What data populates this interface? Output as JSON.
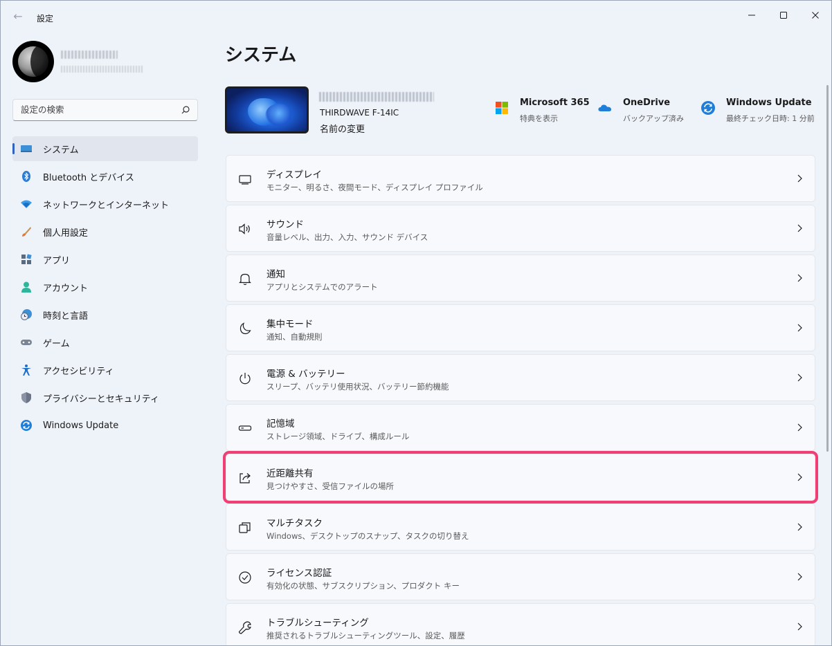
{
  "window": {
    "app_title": "設定",
    "back_glyph": "←"
  },
  "sidebar": {
    "search_placeholder": "設定の検索",
    "items": [
      {
        "label": "システム",
        "icon": "monitor-icon",
        "active": true
      },
      {
        "label": "Bluetooth とデバイス",
        "icon": "bluetooth-icon"
      },
      {
        "label": "ネットワークとインターネット",
        "icon": "wifi-icon"
      },
      {
        "label": "個人用設定",
        "icon": "brush-icon"
      },
      {
        "label": "アプリ",
        "icon": "apps-icon"
      },
      {
        "label": "アカウント",
        "icon": "person-icon"
      },
      {
        "label": "時刻と言語",
        "icon": "clock-globe-icon"
      },
      {
        "label": "ゲーム",
        "icon": "gamepad-icon"
      },
      {
        "label": "アクセシビリティ",
        "icon": "accessibility-icon"
      },
      {
        "label": "プライバシーとセキュリティ",
        "icon": "shield-icon"
      },
      {
        "label": "Windows Update",
        "icon": "update-icon"
      }
    ]
  },
  "main": {
    "title": "システム",
    "device": {
      "model": "THIRDWAVE F-14IC",
      "rename_label": "名前の変更"
    },
    "quick_links": [
      {
        "title": "Microsoft 365",
        "subtitle": "特典を表示",
        "icon": "microsoft-logo-icon"
      },
      {
        "title": "OneDrive",
        "subtitle": "バックアップ済み",
        "icon": "cloud-icon"
      },
      {
        "title": "Windows Update",
        "subtitle": "最終チェック日時: 1 分前",
        "icon": "update-icon"
      }
    ],
    "cards": [
      {
        "title": "ディスプレイ",
        "subtitle": "モニター、明るさ、夜間モード、ディスプレイ プロファイル",
        "icon": "display-icon"
      },
      {
        "title": "サウンド",
        "subtitle": "音量レベル、出力、入力、サウンド デバイス",
        "icon": "speaker-icon"
      },
      {
        "title": "通知",
        "subtitle": "アプリとシステムでのアラート",
        "icon": "bell-icon"
      },
      {
        "title": "集中モード",
        "subtitle": "通知、自動規則",
        "icon": "moon-icon"
      },
      {
        "title": "電源 & バッテリー",
        "subtitle": "スリープ、バッテリ使用状況、バッテリー節約機能",
        "icon": "power-icon"
      },
      {
        "title": "記憶域",
        "subtitle": "ストレージ領域、ドライブ、構成ルール",
        "icon": "storage-icon"
      },
      {
        "title": "近距離共有",
        "subtitle": "見つけやすさ、受信ファイルの場所",
        "icon": "share-icon",
        "highlighted": true
      },
      {
        "title": "マルチタスク",
        "subtitle": "Windows、デスクトップのスナップ、タスクの切り替え",
        "icon": "multitask-icon"
      },
      {
        "title": "ライセンス認証",
        "subtitle": "有効化の状態、サブスクリプション、プロダクト キー",
        "icon": "check-circle-icon"
      },
      {
        "title": "トラブルシューティング",
        "subtitle": "推奨されるトラブルシューティングツール、設定、履歴",
        "icon": "wrench-icon"
      }
    ]
  },
  "colors": {
    "accent": "#2f62c2",
    "highlight": "#ef3f74"
  }
}
